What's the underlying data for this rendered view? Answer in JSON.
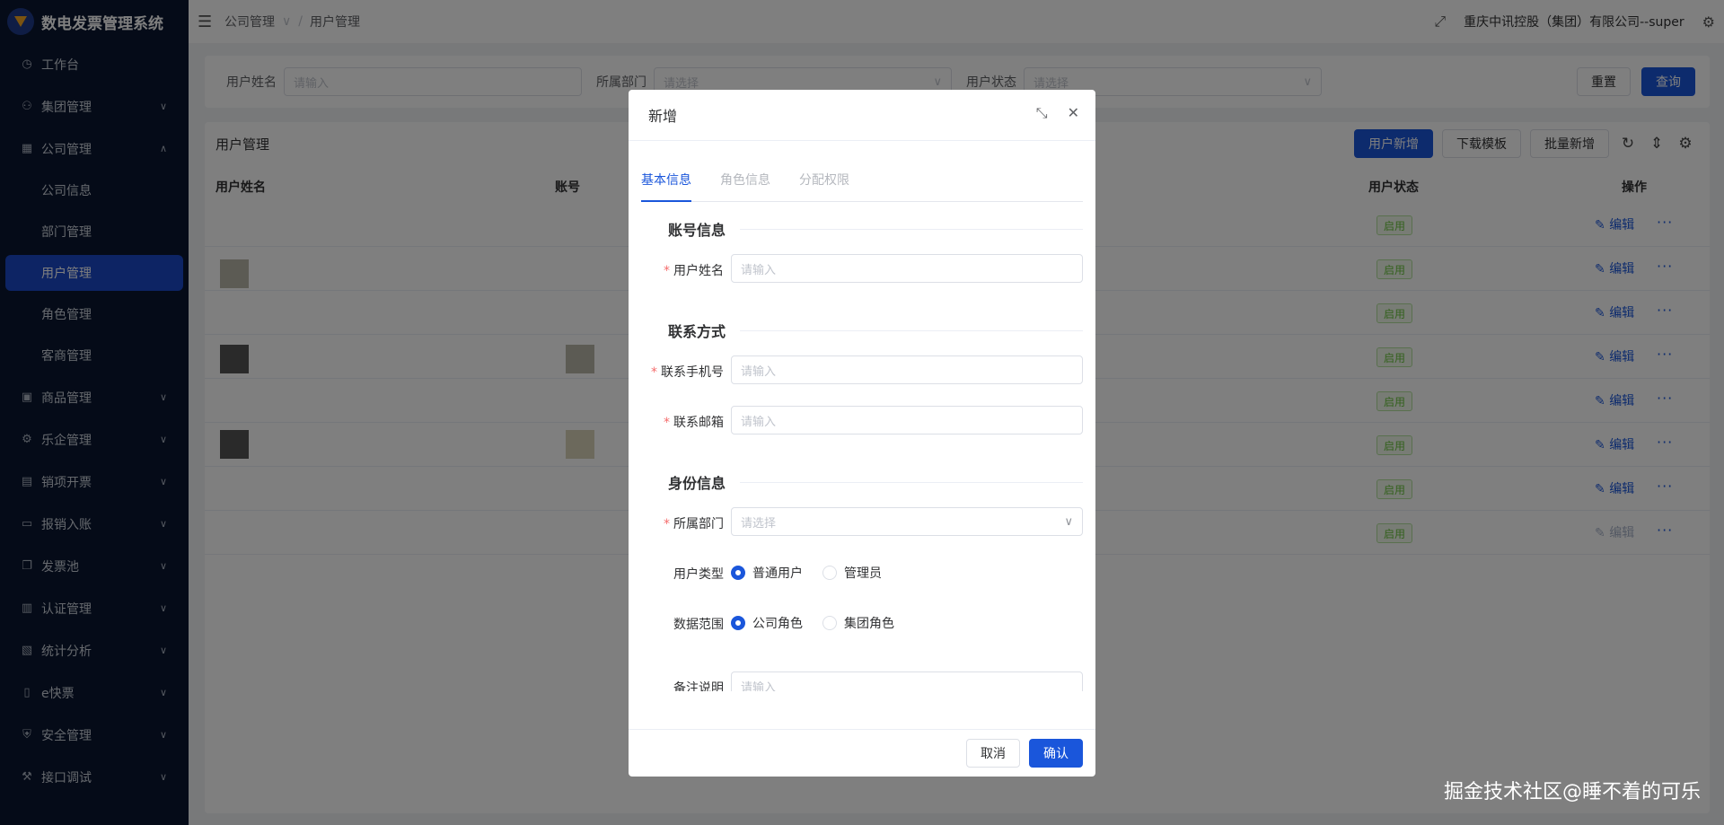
{
  "app": {
    "title": "数电发票管理系统"
  },
  "sidebar": {
    "items": [
      {
        "label": "工作台",
        "icon": "clock-icon",
        "expanded": null
      },
      {
        "label": "集团管理",
        "icon": "org-icon",
        "expanded": false
      },
      {
        "label": "公司管理",
        "icon": "building-icon",
        "expanded": true,
        "children": [
          "公司信息",
          "部门管理",
          "用户管理",
          "角色管理",
          "客商管理"
        ],
        "active_child": "用户管理"
      },
      {
        "label": "商品管理",
        "icon": "box-icon",
        "expanded": false
      },
      {
        "label": "乐企管理",
        "icon": "settings-icon",
        "expanded": false
      },
      {
        "label": "销项开票",
        "icon": "invoice-icon",
        "expanded": false
      },
      {
        "label": "报销入账",
        "icon": "calendar-icon",
        "expanded": false
      },
      {
        "label": "发票池",
        "icon": "copy-icon",
        "expanded": false
      },
      {
        "label": "认证管理",
        "icon": "barcode-icon",
        "expanded": false
      },
      {
        "label": "统计分析",
        "icon": "chart-icon",
        "expanded": false
      },
      {
        "label": "e快票",
        "icon": "doc-icon",
        "expanded": false
      },
      {
        "label": "安全管理",
        "icon": "shield-icon",
        "expanded": false
      },
      {
        "label": "接口调试",
        "icon": "wrench-icon",
        "expanded": false
      }
    ]
  },
  "header": {
    "breadcrumb": [
      "公司管理",
      "用户管理"
    ],
    "company": "重庆中讯控股（集团）有限公司--super"
  },
  "search": {
    "name_label": "用户姓名",
    "name_placeholder": "请输入",
    "dept_label": "所属部门",
    "dept_placeholder": "请选择",
    "status_label": "用户状态",
    "status_placeholder": "请选择",
    "reset": "重置",
    "query": "查询"
  },
  "table": {
    "title": "用户管理",
    "add": "用户新增",
    "download": "下载模板",
    "batch": "批量新增",
    "columns": {
      "name": "用户姓名",
      "account": "账号",
      "status": "用户状态",
      "action": "操作"
    },
    "rows": [
      {
        "status": "启用",
        "edit": "编辑",
        "edit_enabled": true
      },
      {
        "status": "启用",
        "edit": "编辑",
        "edit_enabled": true
      },
      {
        "status": "启用",
        "edit": "编辑",
        "edit_enabled": true
      },
      {
        "status": "启用",
        "edit": "编辑",
        "edit_enabled": true
      },
      {
        "status": "启用",
        "edit": "编辑",
        "edit_enabled": true
      },
      {
        "status": "启用",
        "edit": "编辑",
        "edit_enabled": true
      },
      {
        "status": "启用",
        "edit": "编辑",
        "edit_enabled": true
      },
      {
        "status": "启用",
        "edit": "编辑",
        "edit_enabled": false
      }
    ]
  },
  "dialog": {
    "title": "新增",
    "tabs": [
      "基本信息",
      "角色信息",
      "分配权限"
    ],
    "sections": {
      "account": "账号信息",
      "contact": "联系方式",
      "identity": "身份信息"
    },
    "fields": {
      "username": {
        "label": "用户姓名",
        "placeholder": "请输入"
      },
      "phone": {
        "label": "联系手机号",
        "placeholder": "请输入"
      },
      "email": {
        "label": "联系邮箱",
        "placeholder": "请输入"
      },
      "dept": {
        "label": "所属部门",
        "placeholder": "请选择"
      },
      "user_type": {
        "label": "用户类型",
        "options": [
          "普通用户",
          "管理员"
        ],
        "selected": "普通用户"
      },
      "data_scope": {
        "label": "数据范围",
        "options": [
          "公司角色",
          "集团角色"
        ],
        "selected": "公司角色"
      },
      "remark": {
        "label": "备注说明",
        "placeholder": "请输入"
      }
    },
    "cancel": "取消",
    "confirm": "确认"
  },
  "watermark": "掘金技术社区@睡不着的可乐",
  "colors": {
    "primary": "#1a56db",
    "sidebar_bg": "#0b1730",
    "success": "#67c23a"
  }
}
